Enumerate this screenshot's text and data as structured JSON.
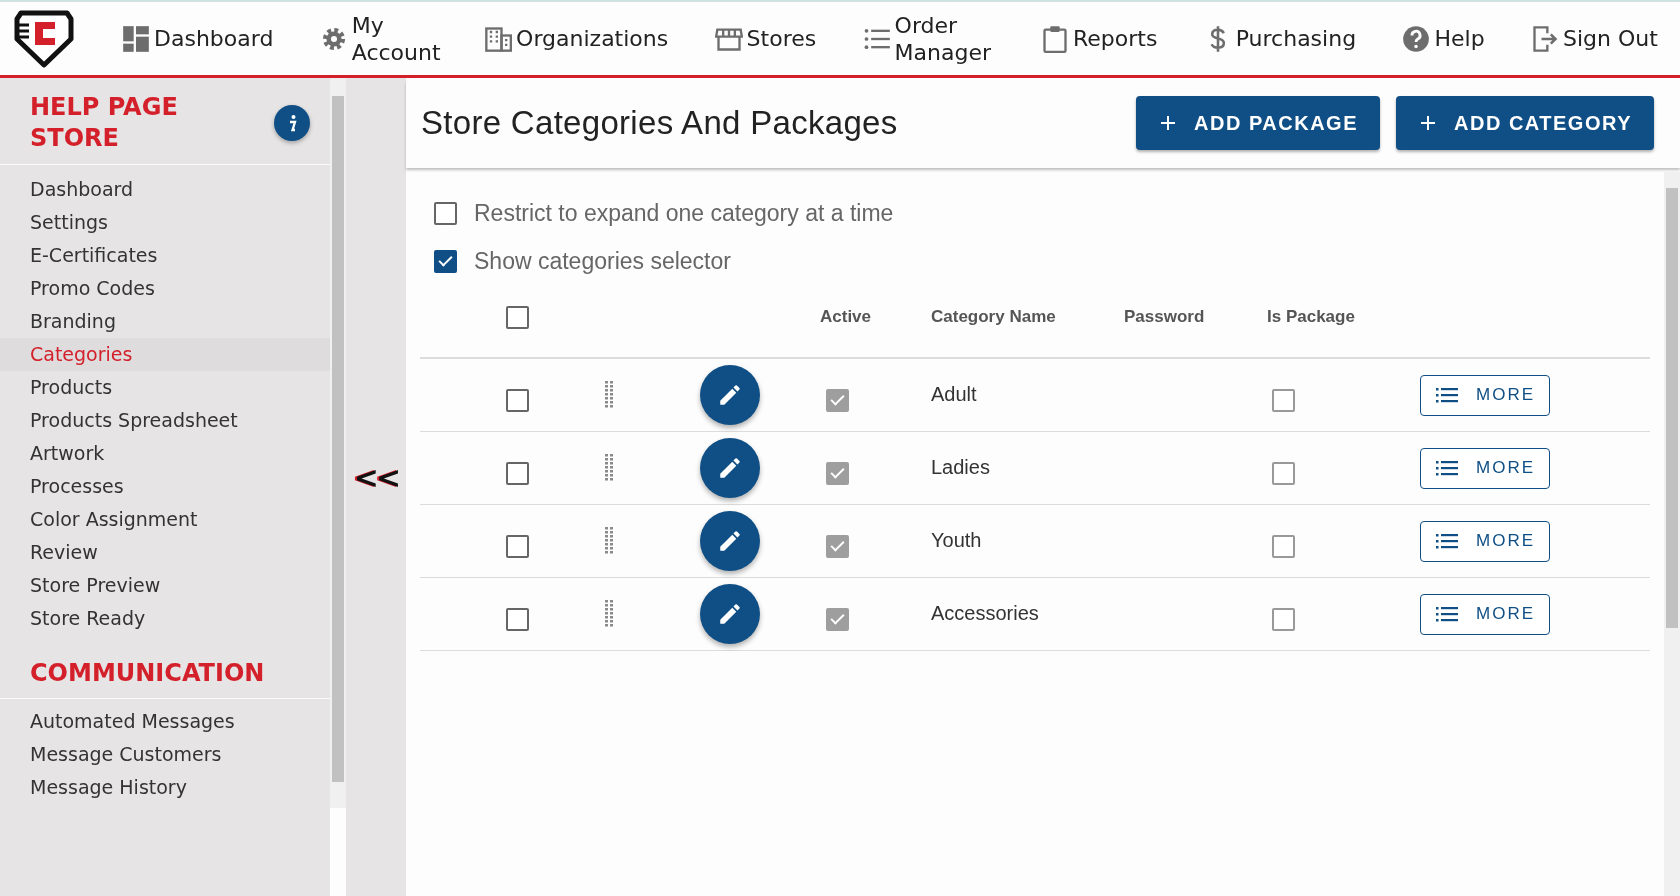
{
  "nav": [
    {
      "label": "Dashboard"
    },
    {
      "label": "My Account"
    },
    {
      "label": "Organizations"
    },
    {
      "label": "Stores"
    },
    {
      "label": "Order Manager"
    },
    {
      "label": "Reports"
    },
    {
      "label": "Purchasing"
    },
    {
      "label": "Help"
    },
    {
      "label": "Sign Out"
    }
  ],
  "sidebar": {
    "sections": [
      {
        "title": "HELP PAGE STORE",
        "info": true,
        "items": [
          {
            "label": "Dashboard",
            "selected": false
          },
          {
            "label": "Settings",
            "selected": false
          },
          {
            "label": "E-Certificates",
            "selected": false
          },
          {
            "label": "Promo Codes",
            "selected": false
          },
          {
            "label": "Branding",
            "selected": false
          },
          {
            "label": "Categories",
            "selected": true
          },
          {
            "label": "Products",
            "selected": false
          },
          {
            "label": "Products Spreadsheet",
            "selected": false
          },
          {
            "label": "Artwork",
            "selected": false
          },
          {
            "label": "Processes",
            "selected": false
          },
          {
            "label": "Color Assignment",
            "selected": false
          },
          {
            "label": "Review",
            "selected": false
          },
          {
            "label": "Store Preview",
            "selected": false
          },
          {
            "label": "Store Ready",
            "selected": false
          }
        ]
      },
      {
        "title": "COMMUNICATION",
        "info": false,
        "items": [
          {
            "label": "Automated Messages",
            "selected": false
          },
          {
            "label": "Message Customers",
            "selected": false
          },
          {
            "label": "Message History",
            "selected": false
          }
        ]
      }
    ],
    "collapse_label": "<<"
  },
  "page": {
    "title": "Store Categories And Packages",
    "buttons": [
      {
        "label": "ADD PACKAGE"
      },
      {
        "label": "ADD CATEGORY"
      }
    ]
  },
  "options": [
    {
      "label": "Restrict to expand one category at a time",
      "checked": false
    },
    {
      "label": "Show categories selector",
      "checked": true
    }
  ],
  "table": {
    "select_all": false,
    "columns": [
      "Active",
      "Category Name",
      "Password",
      "Is Package"
    ],
    "rows": [
      {
        "selected": false,
        "active": true,
        "name": "Adult",
        "is_package": false,
        "action": "MORE"
      },
      {
        "selected": false,
        "active": true,
        "name": "Ladies",
        "is_package": false,
        "action": "MORE"
      },
      {
        "selected": false,
        "active": true,
        "name": "Youth",
        "is_package": false,
        "action": "MORE"
      },
      {
        "selected": false,
        "active": true,
        "name": "Accessories",
        "is_package": false,
        "action": "MORE"
      }
    ]
  }
}
